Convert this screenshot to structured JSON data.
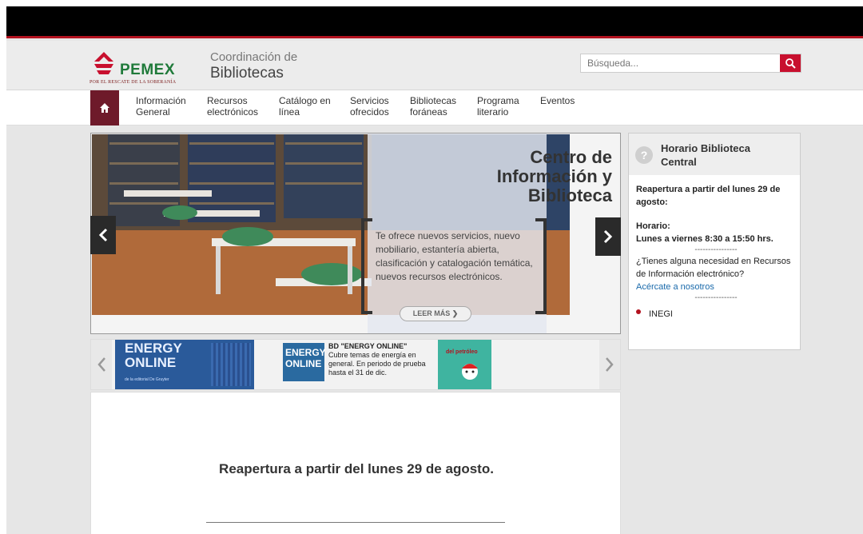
{
  "header": {
    "logo_word": "PEMEX",
    "logo_tagline": "POR EL RESCATE DE LA SOBERANÍA",
    "site_title_line1": "Coordinación de",
    "site_title_line2": "Bibliotecas"
  },
  "search": {
    "placeholder": "Búsqueda...",
    "value": "",
    "button_icon": "search-icon"
  },
  "nav": {
    "home_icon": "home-icon",
    "items": [
      {
        "line1": "Información",
        "line2": "General"
      },
      {
        "line1": "Recursos",
        "line2": "electrónicos"
      },
      {
        "line1": "Catálogo en",
        "line2": "línea"
      },
      {
        "line1": "Servicios",
        "line2": "ofrecidos"
      },
      {
        "line1": "Bibliotecas",
        "line2": "foráneas"
      },
      {
        "line1": "Programa",
        "line2": "literario"
      },
      {
        "line1": "Eventos",
        "line2": ""
      }
    ]
  },
  "slider": {
    "title_line1": "Centro de",
    "title_line2": "Información y",
    "title_line3": "Biblioteca",
    "text": "Te ofrece nuevos servicios, nuevo mobiliario, estantería abierta, clasificación y catalogación temática, nuevos recursos electrónicos.",
    "button_label": "LEER MÁS",
    "prev_icon": "chevron-left-icon",
    "next_icon": "chevron-right-icon"
  },
  "carousel": {
    "banner_line1": "ENERGY",
    "banner_line2": "ONLINE",
    "banner_sub": "de la editorial De Gruyter",
    "small_line1": "ENERGY",
    "small_line2": "ONLINE",
    "item_title": "BD \"ENERGY ONLINE\"",
    "item_text": "Cubre temas de energía en general. En periodo de prueba hasta el 31 de dic.",
    "petroleo_label": "del petróleo"
  },
  "content": {
    "heading": "Reapertura a partir del lunes 29 de agosto."
  },
  "sidebar": {
    "title_line1": "Horario Biblioteca",
    "title_line2": "Central",
    "reopen": "Reapertura a partir del lunes 29 de agosto:",
    "horario_label": "Horario:",
    "horario_value": "Lunes a viernes 8:30 a 15:50 hrs.",
    "separator": "----------------",
    "question": "¿Tienes alguna necesidad en Recursos de Información electrónico?",
    "link": "Acércate a nosotros",
    "inegi": "INEGI"
  },
  "colors": {
    "brand_red": "#c8102e",
    "home_maroon": "#6e1a2a",
    "link_blue": "#1a6aab"
  }
}
